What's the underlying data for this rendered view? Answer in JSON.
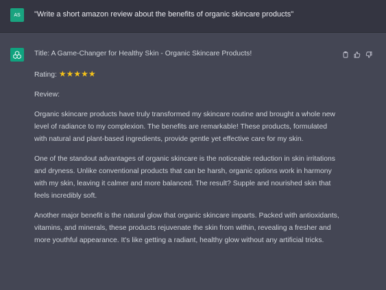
{
  "user": {
    "avatar_initials": "AS",
    "message": "\"Write a short amazon review about the benefits of organic skincare products\""
  },
  "assistant": {
    "title": "Title: A Game-Changer for Healthy Skin - Organic Skincare Products!",
    "rating_label": "Rating:",
    "rating_stars": "★★★★★",
    "review_label": "Review:",
    "paragraphs": [
      "Organic skincare products have truly transformed my skincare routine and brought a whole new level of radiance to my complexion. The benefits are remarkable! These products, formulated with natural and plant-based ingredients, provide gentle yet effective care for my skin.",
      "One of the standout advantages of organic skincare is the noticeable reduction in skin irritations and dryness. Unlike conventional products that can be harsh, organic options work in harmony with my skin, leaving it calmer and more balanced. The result? Supple and nourished skin that feels incredibly soft.",
      "Another major benefit is the natural glow that organic skincare imparts. Packed with antioxidants, vitamins, and minerals, these products rejuvenate the skin from within, revealing a fresher and more youthful appearance. It's like getting a radiant, healthy glow without any artificial tricks."
    ],
    "actions": [
      "copy-icon",
      "thumbs-up-icon",
      "thumbs-down-icon"
    ]
  },
  "colors": {
    "user_row_bg": "#343541",
    "assistant_row_bg": "#444654",
    "user_avatar": "#19a37f",
    "bot_avatar": "#10a37f",
    "text": "#d1d5db",
    "star": "#f4c21a"
  }
}
